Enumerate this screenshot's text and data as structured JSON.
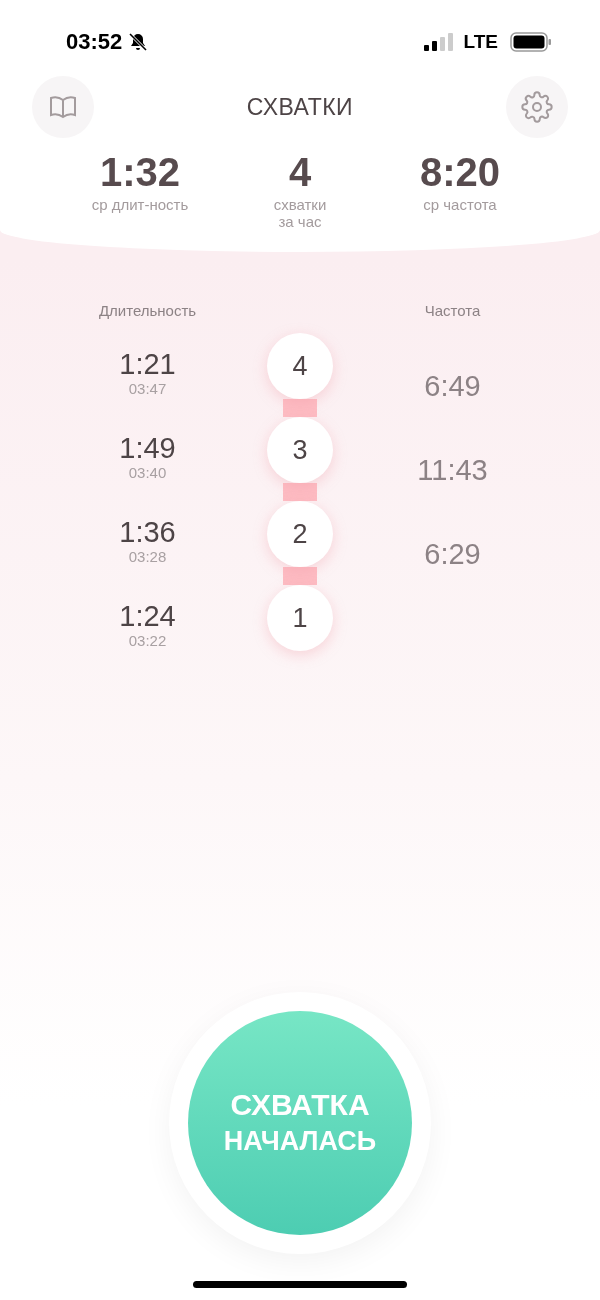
{
  "status_bar": {
    "time": "03:52",
    "network": "LTE"
  },
  "header": {
    "title": "СХВАТКИ"
  },
  "stats": [
    {
      "value": "1:32",
      "label": "ср длит-ность"
    },
    {
      "value": "4",
      "label": "схватки за час"
    },
    {
      "value": "8:20",
      "label": "ср частота"
    }
  ],
  "columns": {
    "duration": "Длительность",
    "frequency": "Частота"
  },
  "contractions": [
    {
      "number": "4",
      "duration": "1:21",
      "start": "03:47"
    },
    {
      "number": "3",
      "duration": "1:49",
      "start": "03:40"
    },
    {
      "number": "2",
      "duration": "1:36",
      "start": "03:28"
    },
    {
      "number": "1",
      "duration": "1:24",
      "start": "03:22"
    }
  ],
  "frequencies": [
    "6:49",
    "11:43",
    "6:29"
  ],
  "start_button": {
    "lines": [
      "СХВАТКА",
      "НАЧАЛАСЬ"
    ]
  }
}
